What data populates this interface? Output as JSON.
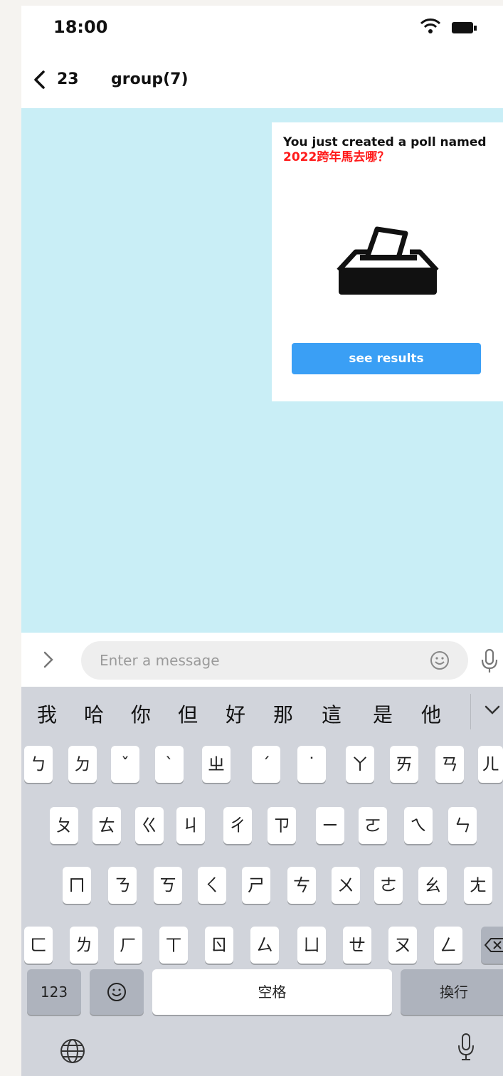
{
  "status_bar": {
    "time": "18:00",
    "wifi_icon": "wifi-icon",
    "battery_icon": "battery-icon"
  },
  "nav": {
    "back_count": "23",
    "title": "group(7)"
  },
  "message": {
    "text_before": "You just created a poll named ",
    "poll_name": "2022跨年馬去哪？",
    "poll_name_color": "#ff1a1a",
    "icon": "ballot-box-icon",
    "button_label": "see results",
    "button_color": "#3a9ff5"
  },
  "input": {
    "placeholder": "Enter a message"
  },
  "keyboard": {
    "candidates": [
      "我",
      "哈",
      "你",
      "但",
      "好",
      "那",
      "這",
      "是",
      "他"
    ],
    "row1": [
      "ㄅ",
      "ㄉ",
      "ˇ",
      "ˋ",
      "ㄓ",
      "ˊ",
      "˙",
      "ㄚ",
      "ㄞ",
      "ㄢ",
      "ㄦ"
    ],
    "row2": [
      "ㄆ",
      "ㄊ",
      "ㄍ",
      "ㄐ",
      "ㄔ",
      "ㄗ",
      "ㄧ",
      "ㄛ",
      "ㄟ",
      "ㄣ"
    ],
    "row3": [
      "ㄇ",
      "ㄋ",
      "ㄎ",
      "ㄑ",
      "ㄕ",
      "ㄘ",
      "ㄨ",
      "ㄜ",
      "ㄠ",
      "ㄤ"
    ],
    "row4": [
      "ㄈ",
      "ㄌ",
      "ㄏ",
      "ㄒ",
      "ㄖ",
      "ㄙ",
      "ㄩ",
      "ㄝ",
      "ㄡ",
      "ㄥ"
    ],
    "key_123": "123",
    "key_space": "空格",
    "key_return": "換行"
  },
  "colors": {
    "chat_background": "#c9eef6",
    "keyboard_background": "#d1d4db"
  }
}
